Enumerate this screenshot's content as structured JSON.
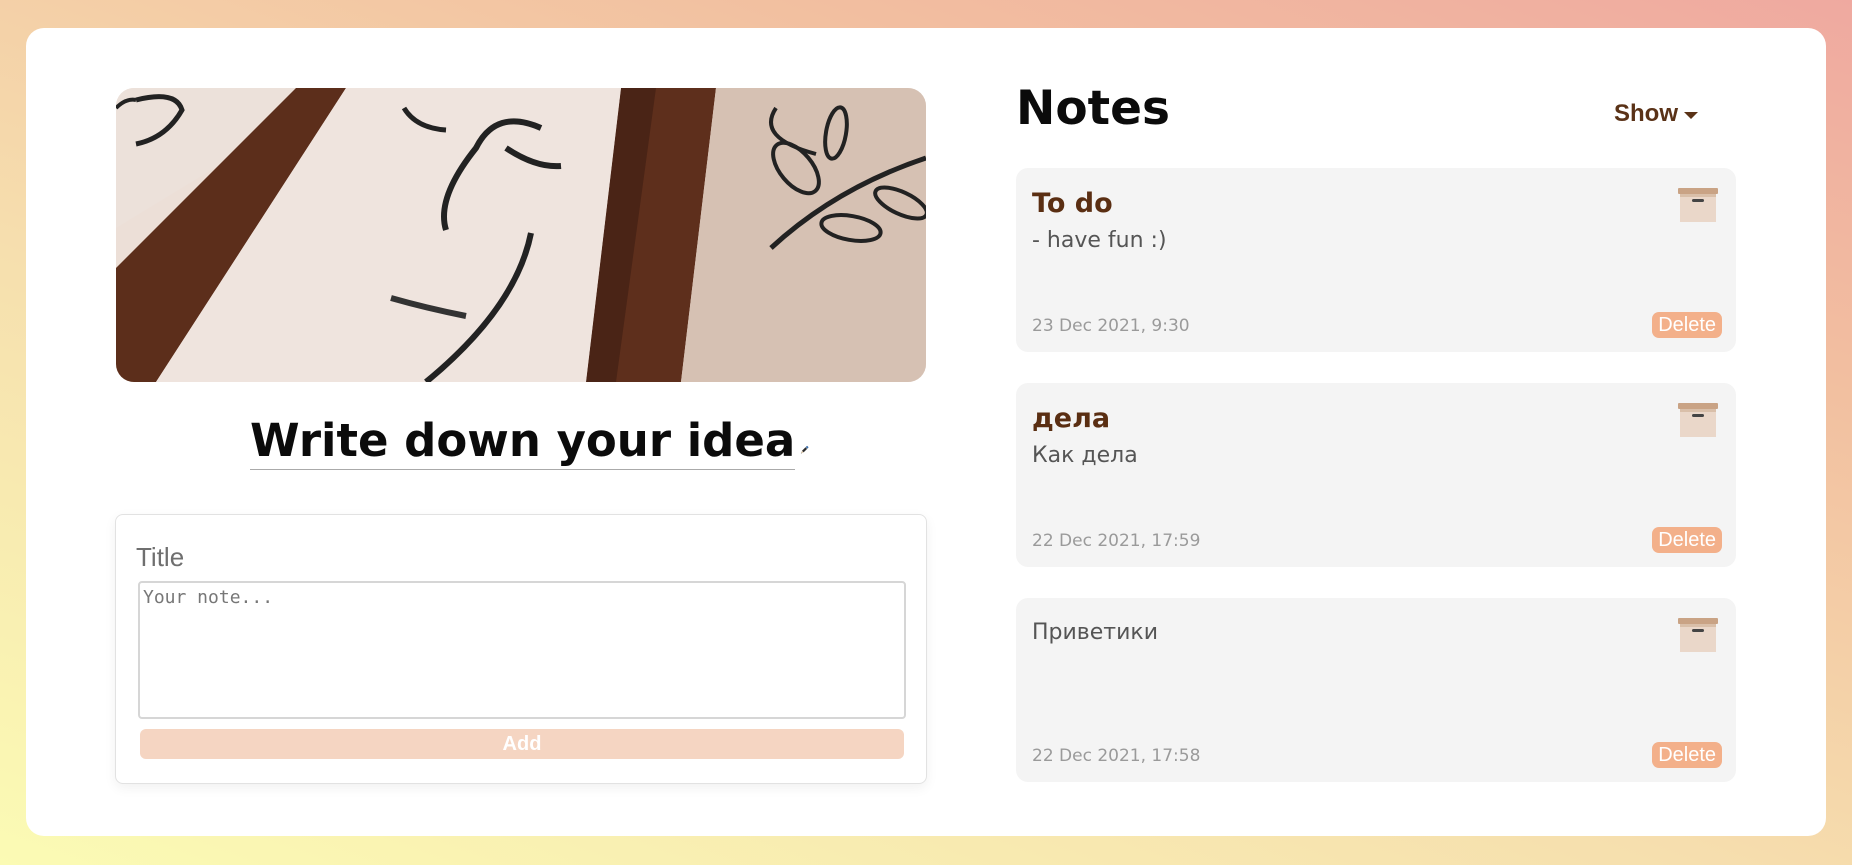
{
  "hero": {
    "image": "ink-brush-drawings-on-paper"
  },
  "headline": {
    "text": "Write down your idea",
    "icon": "pencil-icon"
  },
  "form": {
    "title_placeholder": "Title",
    "note_placeholder": "Your note...",
    "add_label": "Add"
  },
  "notes_panel": {
    "title": "Notes",
    "show_label": "Show",
    "notes": [
      {
        "title": "To do",
        "body": "- have fun :)",
        "date": "23 Dec 2021, 9:30",
        "delete_label": "Delete"
      },
      {
        "title": "дела",
        "body": "Как дела",
        "date": "22 Dec 2021, 17:59",
        "delete_label": "Delete"
      },
      {
        "title": "",
        "body": "Приветики",
        "date": "22 Dec 2021, 17:58",
        "delete_label": "Delete"
      }
    ]
  },
  "colors": {
    "accent": "#f3b08a",
    "add_button": "#f5d5c2",
    "note_title": "#5a2e12",
    "card_bg": "#f4f4f4"
  }
}
